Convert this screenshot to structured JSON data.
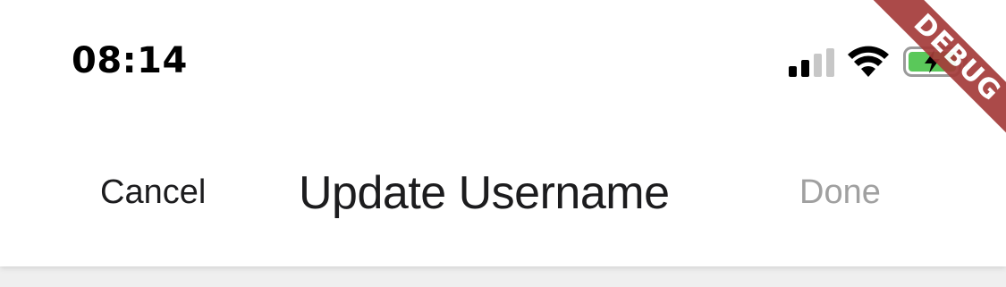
{
  "status_bar": {
    "time": "08:14",
    "signal_icon": "cellular-signal-icon",
    "wifi_icon": "wifi-icon",
    "battery_icon": "battery-charging-icon",
    "battery_color": "#5ac85a",
    "signal_active_color": "#000000",
    "signal_inactive_color": "#c7c7c7"
  },
  "nav_bar": {
    "cancel_label": "Cancel",
    "title": "Update Username",
    "done_label": "Done",
    "done_color": "#a0a0a0"
  },
  "debug_banner": {
    "label": "DEBUG",
    "color": "#a43b3a"
  }
}
